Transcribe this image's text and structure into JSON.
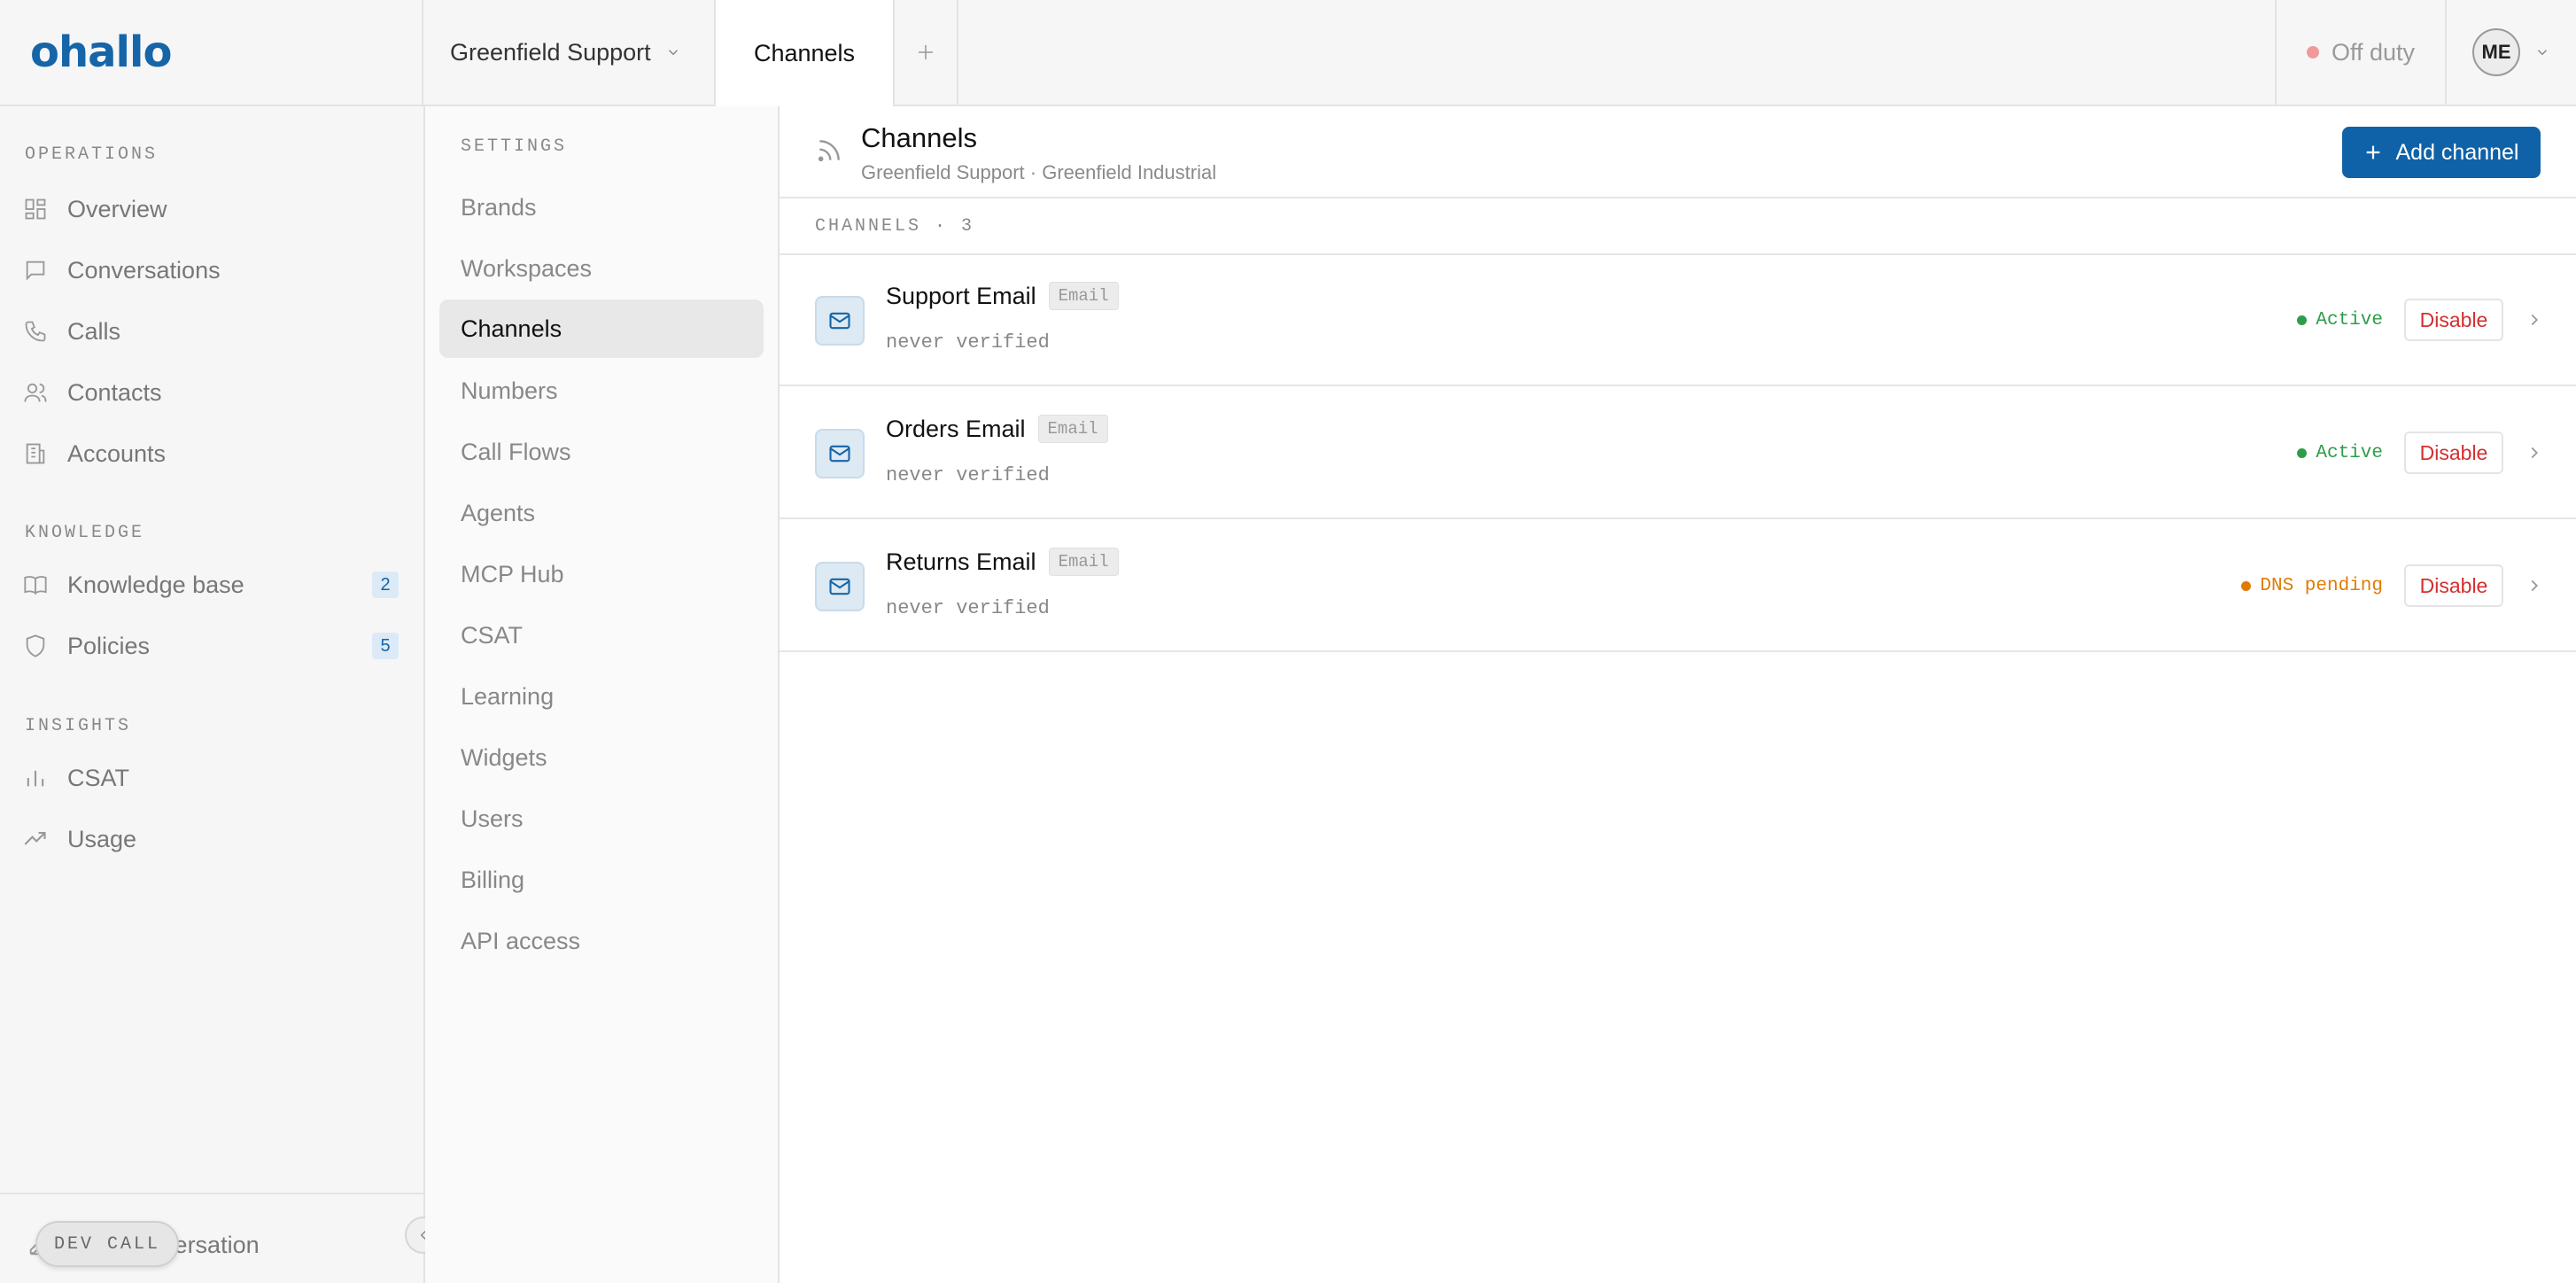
{
  "app": {
    "logo": "ohallo",
    "workspace": "Greenfield Support",
    "active_tab": "Channels",
    "duty_status": "Off duty",
    "user_initials": "ME"
  },
  "sidebar": {
    "sections": [
      {
        "label": "OPERATIONS",
        "items": [
          {
            "label": "Overview",
            "icon": "grid-icon"
          },
          {
            "label": "Conversations",
            "icon": "chat-icon"
          },
          {
            "label": "Calls",
            "icon": "phone-icon"
          },
          {
            "label": "Contacts",
            "icon": "users-icon"
          },
          {
            "label": "Accounts",
            "icon": "building-icon"
          }
        ]
      },
      {
        "label": "KNOWLEDGE",
        "items": [
          {
            "label": "Knowledge base",
            "icon": "book-icon",
            "badge": "2"
          },
          {
            "label": "Policies",
            "icon": "shield-icon",
            "badge": "5"
          }
        ]
      },
      {
        "label": "INSIGHTS",
        "items": [
          {
            "label": "CSAT",
            "icon": "bar-chart-icon"
          },
          {
            "label": "Usage",
            "icon": "trend-icon"
          }
        ]
      }
    ],
    "footer": {
      "new_conversation": "New conversation",
      "dev_call": "DEV CALL"
    }
  },
  "settings": {
    "label": "SETTINGS",
    "items": [
      "Brands",
      "Workspaces",
      "Channels",
      "Numbers",
      "Call Flows",
      "Agents",
      "MCP Hub",
      "CSAT",
      "Learning",
      "Widgets",
      "Users",
      "Billing",
      "API access"
    ],
    "active": "Channels"
  },
  "main": {
    "title": "Channels",
    "subtitle": "Greenfield Support · Greenfield Industrial",
    "add_button": "Add channel",
    "list_header": "CHANNELS · 3",
    "channels": [
      {
        "name": "Support Email",
        "type": "Email",
        "verified": "never verified",
        "status": "Active",
        "status_color": "#2e9d4a",
        "action": "Disable"
      },
      {
        "name": "Orders Email",
        "type": "Email",
        "verified": "never verified",
        "status": "Active",
        "status_color": "#2e9d4a",
        "action": "Disable"
      },
      {
        "name": "Returns Email",
        "type": "Email",
        "verified": "never verified",
        "status": "DNS pending",
        "status_color": "#e07b00",
        "action": "Disable"
      }
    ]
  },
  "colors": {
    "brand": "#1565a8",
    "primary_button": "#0f62a8",
    "danger": "#d32f2f"
  }
}
